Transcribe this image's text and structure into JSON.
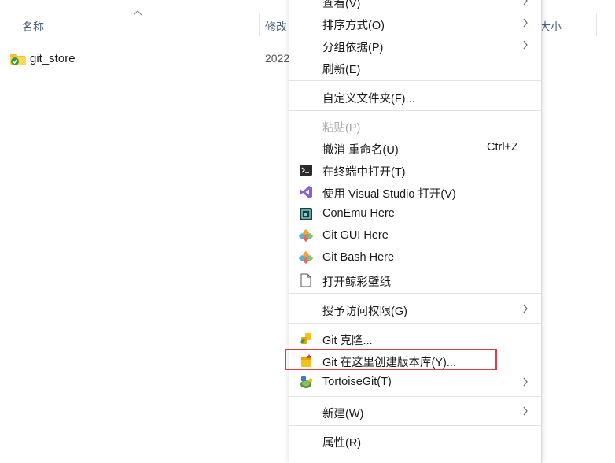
{
  "columns": {
    "name": "名称",
    "modified": "修改日期",
    "size": "大小"
  },
  "files": [
    {
      "name": "git_store",
      "date": "2022"
    }
  ],
  "menu": {
    "view": "查看(V)",
    "sort_by": "排序方式(O)",
    "group_by": "分组依据(P)",
    "refresh": "刷新(E)",
    "customize_folder": "自定义文件夹(F)...",
    "paste": "粘贴(P)",
    "undo_rename": "撤消 重命名(U)",
    "undo_shortcut": "Ctrl+Z",
    "open_terminal": "在终端中打开(T)",
    "open_vs": "使用 Visual Studio 打开(V)",
    "conemu": "ConEmu Here",
    "git_gui": "Git GUI Here",
    "git_bash": "Git Bash Here",
    "open_wallpaper": "打开鲸彩壁纸",
    "grant_access": "授予访问权限(G)",
    "git_clone": "Git 克隆...",
    "git_create_repo": "Git 在这里创建版本库(Y)...",
    "tortoisegit": "TortoiseGit(T)",
    "new": "新建(W)",
    "properties": "属性(R)"
  },
  "icons": {
    "folder": "folder-git-icon",
    "terminal": "terminal-icon",
    "visual_studio": "visual-studio-icon",
    "conemu": "conemu-icon",
    "git": "git-icon",
    "document": "document-icon",
    "clone": "git-clone-icon",
    "create_repo": "git-create-repo-icon",
    "tortoise": "tortoisegit-icon"
  },
  "colors": {
    "highlight_border": "#e0393e",
    "header_text": "#4c607a"
  }
}
